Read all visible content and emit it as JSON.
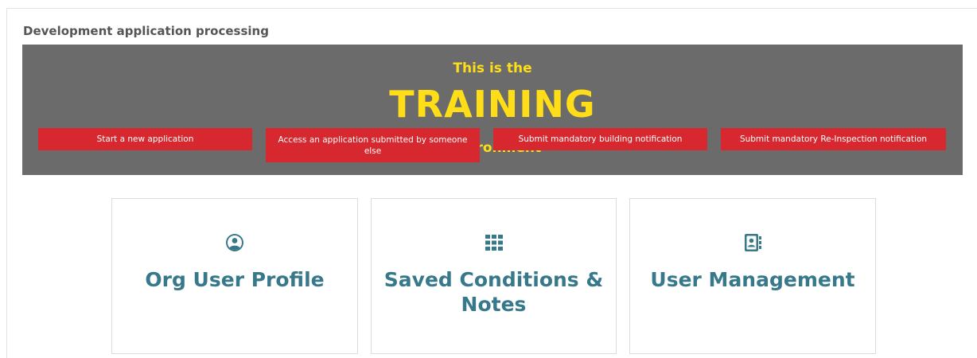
{
  "section": {
    "title": "Development application processing"
  },
  "banner": {
    "line1": "This is the",
    "line2": "TRAINING",
    "line3": "Environment",
    "text_color": "#ffde17",
    "background": "#6b6b6b"
  },
  "actions": [
    {
      "label": "Start a new application"
    },
    {
      "label": "Access an application submitted by someone else"
    },
    {
      "label": "Submit mandatory building notification"
    },
    {
      "label": "Submit mandatory Re-Inspection notification"
    }
  ],
  "action_color": "#d8282f",
  "cards": [
    {
      "icon": "user-circle-icon",
      "title": "Org User Profile"
    },
    {
      "icon": "grid-icon",
      "title": "Saved Conditions & Notes"
    },
    {
      "icon": "address-book-icon",
      "title": "User Management"
    }
  ],
  "card_accent": "#37798a"
}
